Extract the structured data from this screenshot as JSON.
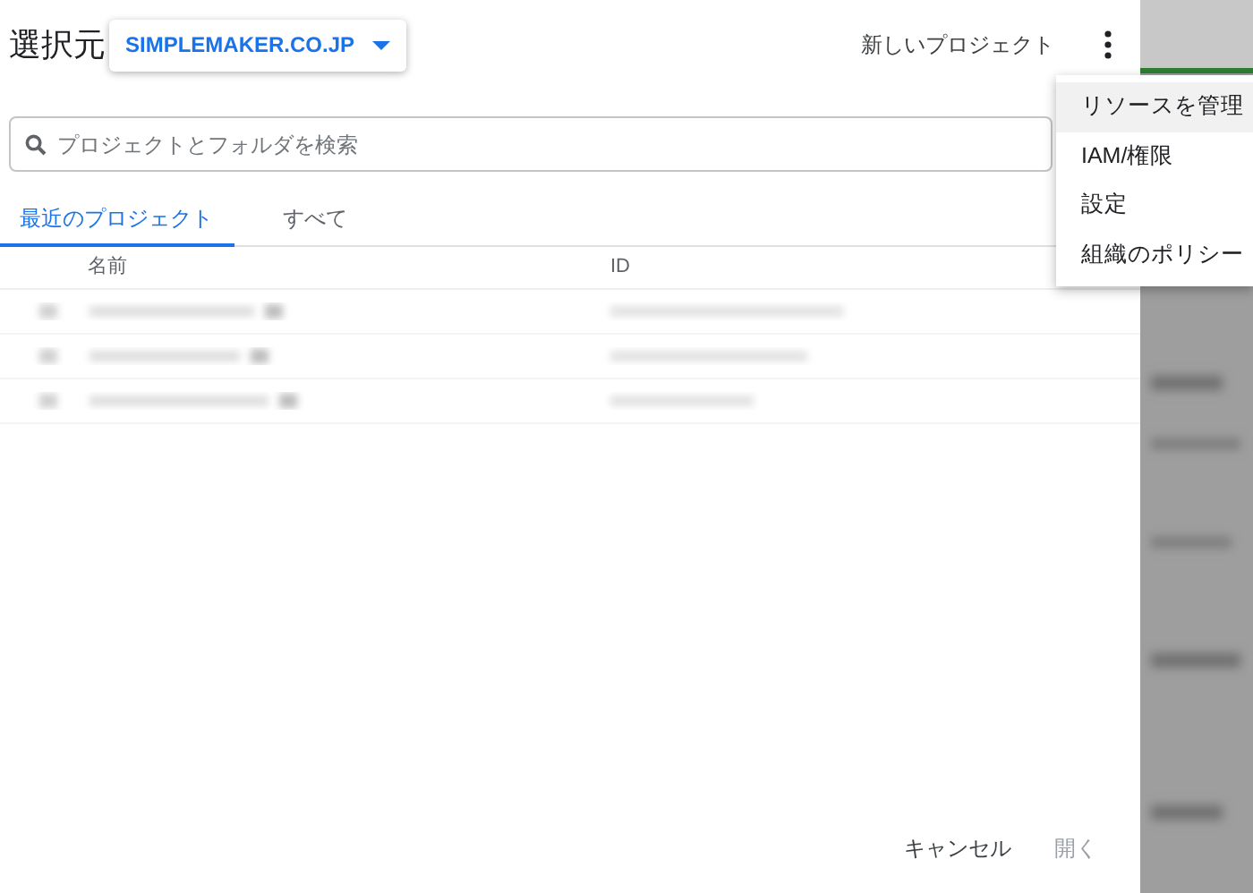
{
  "dialog": {
    "title": "選択元",
    "organization": "SIMPLEMAKER.CO.JP",
    "new_project": "新しいプロジェクト",
    "search": {
      "placeholder": "プロジェクトとフォルダを検索"
    },
    "tabs": [
      {
        "label": "最近のプロジェクト",
        "selected": true
      },
      {
        "label": "すべて",
        "selected": false
      }
    ],
    "table": {
      "columns": [
        "名前",
        "ID"
      ],
      "rows": [
        {
          "kind": "redacted"
        },
        {
          "kind": "redacted"
        },
        {
          "kind": "redacted"
        }
      ]
    },
    "buttons": [
      {
        "label": "キャンセル",
        "disabled": false
      },
      {
        "label": "開く",
        "disabled": true
      }
    ]
  },
  "menu": {
    "items": [
      {
        "label": "リソースを管理",
        "selected": true
      },
      {
        "label": "IAM/権限",
        "selected": false
      },
      {
        "label": "設定",
        "selected": false
      },
      {
        "label": "組織のポリシー",
        "selected": false
      }
    ]
  }
}
